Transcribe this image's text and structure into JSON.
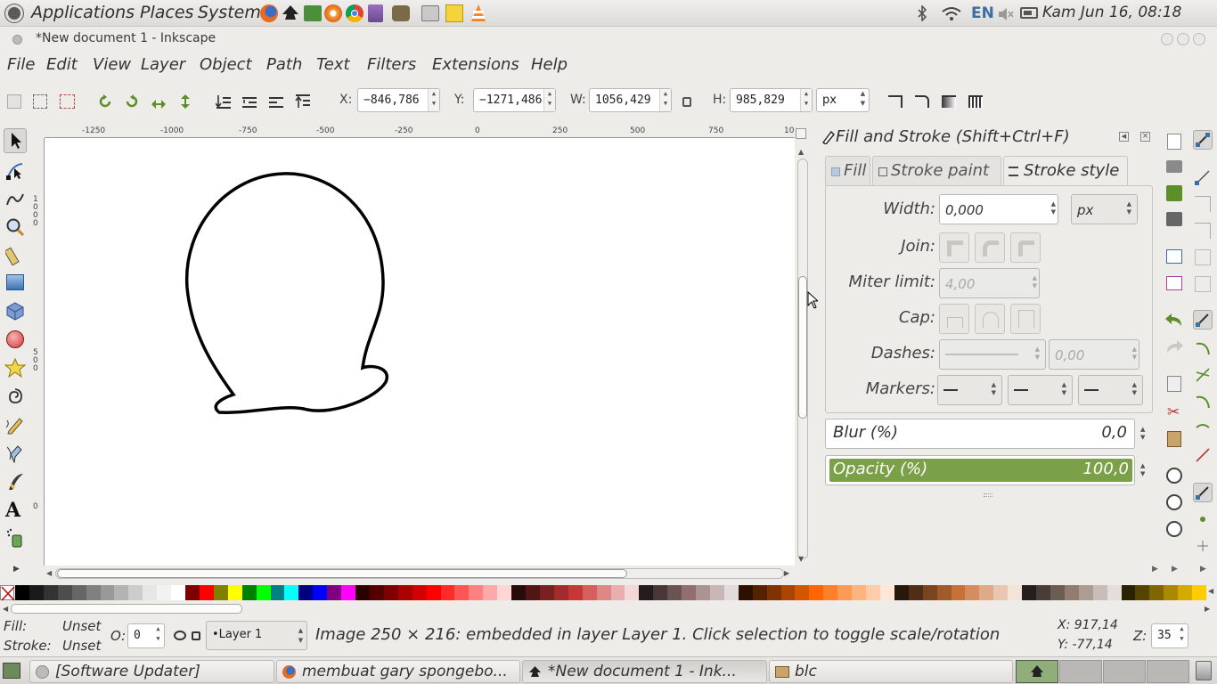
{
  "top_panel": {
    "menus": [
      "Applications",
      "Places",
      "System"
    ],
    "language": "EN",
    "clock": "Kam Jun 16, 08:18"
  },
  "window": {
    "title": "*New document 1 - Inkscape"
  },
  "menubar": [
    "File",
    "Edit",
    "View",
    "Layer",
    "Object",
    "Path",
    "Text",
    "Filters",
    "Extensions",
    "Help"
  ],
  "toolbar": {
    "x_label": "X:",
    "x_value": "−846,786",
    "y_label": "Y:",
    "y_value": "−1271,486",
    "w_label": "W:",
    "w_value": "1056,429",
    "h_label": "H:",
    "h_value": "985,829",
    "unit": "px"
  },
  "ruler": {
    "labels": [
      "-1250",
      "-1000",
      "-750",
      "-500",
      "-250",
      "0",
      "250",
      "500",
      "750",
      "10"
    ],
    "v_labels": [
      "1000",
      "500",
      "0"
    ]
  },
  "dock": {
    "title": "Fill and Stroke (Shift+Ctrl+F)",
    "tabs": [
      "Fill",
      "Stroke paint",
      "Stroke style"
    ],
    "width_label": "Width:",
    "width_value": "0,000",
    "width_unit": "px",
    "join_label": "Join:",
    "miter_label": "Miter limit:",
    "miter_value": "4,00",
    "cap_label": "Cap:",
    "dashes_label": "Dashes:",
    "dashes_value": "0,00",
    "markers_label": "Markers:",
    "blur_label": "Blur (%)",
    "blur_value": "0,0",
    "opacity_label": "Opacity (%)",
    "opacity_value": "100,0",
    "opacity_fraction": 1.0,
    "opacity_color": "#7aa048"
  },
  "status": {
    "fill_label": "Fill:",
    "fill_value": "Unset",
    "stroke_label": "Stroke:",
    "stroke_value": "Unset",
    "o_label": "O:",
    "o_value": "0",
    "layer": "•Layer 1",
    "message": "Image 250 × 216: embedded in layer Layer 1. Click selection to toggle scale/rotation",
    "x_coord": "X: 917,14",
    "y_coord": "Y: -77,14",
    "z_label": "Z:",
    "z_value": "35"
  },
  "taskbar": [
    {
      "label": "[Software Updater]"
    },
    {
      "label": "membuat gary spongebo..."
    },
    {
      "label": "*New document 1 - Ink..."
    },
    {
      "label": "blc"
    }
  ],
  "palette": [
    "#000000",
    "#1a1a1a",
    "#333333",
    "#4d4d4d",
    "#666666",
    "#808080",
    "#999999",
    "#b3b3b3",
    "#cccccc",
    "#e6e6e6",
    "#f2f2f2",
    "#ffffff",
    "#800000",
    "#ff0000",
    "#808000",
    "#ffff00",
    "#008000",
    "#00ff00",
    "#008080",
    "#00ffff",
    "#000080",
    "#0000ff",
    "#800080",
    "#ff00ff",
    "#2b0000",
    "#550000",
    "#800000",
    "#aa0000",
    "#d40000",
    "#ff0000",
    "#ff2a2a",
    "#ff5555",
    "#ff8080",
    "#ffaaaa",
    "#ffd5d5",
    "#280b0b",
    "#501616",
    "#782121",
    "#a02c2c",
    "#c83737",
    "#d35f5f",
    "#de8787",
    "#e9afaf",
    "#f4d7d7",
    "#241c1c",
    "#483737",
    "#6c5353",
    "#916f6f",
    "#ac9393",
    "#c8b7b7",
    "#e3dbdb",
    "#2b1100",
    "#552200",
    "#803300",
    "#aa4400",
    "#d45500",
    "#ff6600",
    "#ff7f2a",
    "#ff9955",
    "#ffb380",
    "#ffccaa",
    "#ffe6d5",
    "#28170b",
    "#502d16",
    "#784421",
    "#a05a2c",
    "#c87137",
    "#d38d5f",
    "#deaa87",
    "#e9c6af",
    "#f4e3d7",
    "#241f1c",
    "#483e37",
    "#6c5d53",
    "#917c6f",
    "#ac9d93",
    "#c8beb7",
    "#e3dedb",
    "#2b2200",
    "#554400",
    "#806600",
    "#aa8800",
    "#d4aa00",
    "#ffcc00"
  ]
}
